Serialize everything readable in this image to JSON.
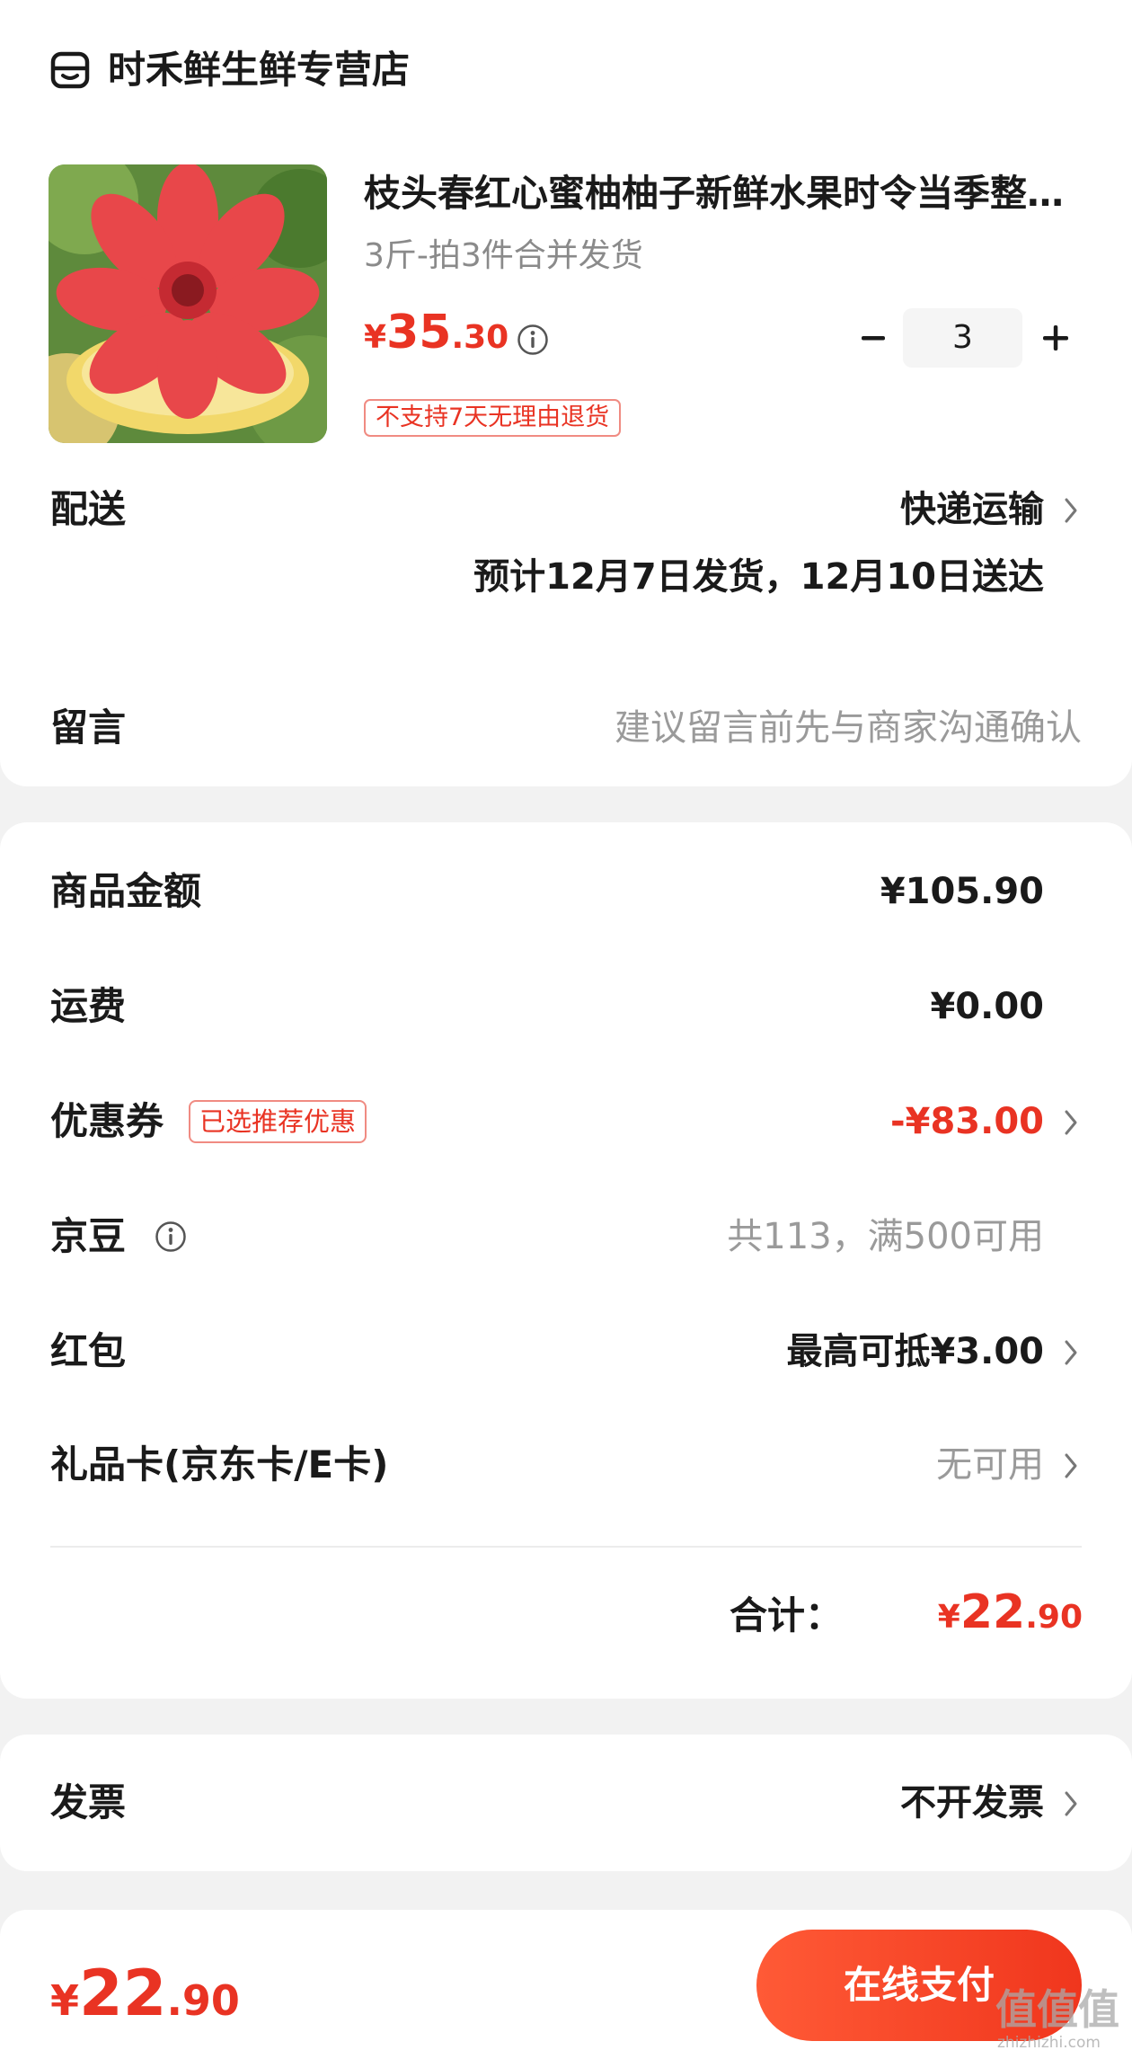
{
  "store": {
    "name": "时禾鲜生鲜专营店",
    "icon": "store-icon"
  },
  "product": {
    "title": "枝头春红心蜜柚柚子新鲜水果时令当季整箱包邮",
    "spec": "3斤-拍3件合并发货",
    "price": {
      "currency": "¥",
      "integer": "35",
      "decimal": ".30"
    },
    "return_tag": "不支持7天无理由退货",
    "quantity": "3",
    "minus_label": "−",
    "plus_label": "+"
  },
  "shipping": {
    "label": "配送",
    "method": "快递运输",
    "estimate": "预计12月7日发货，12月10日送达"
  },
  "remark": {
    "label": "留言",
    "placeholder": "建议留言前先与商家沟通确认"
  },
  "summary": {
    "goods_amount": {
      "label": "商品金额",
      "value": "¥105.90"
    },
    "freight": {
      "label": "运费",
      "value": "¥0.00"
    },
    "coupon": {
      "label": "优惠券",
      "tag": "已选推荐优惠",
      "value": "-¥83.00"
    },
    "jingdou": {
      "label": "京豆",
      "value": "共113，满500可用"
    },
    "red_packet": {
      "label": "红包",
      "value": "最高可抵¥3.00"
    },
    "gift_card": {
      "label": "礼品卡(京东卡/E卡)",
      "value": "无可用"
    },
    "total": {
      "label": "合计：",
      "currency": "¥",
      "integer": "22",
      "decimal": ".90"
    }
  },
  "invoice": {
    "label": "发票",
    "value": "不开发票"
  },
  "bottom_bar": {
    "price": {
      "currency": "¥",
      "integer": "22",
      "decimal": ".90"
    },
    "pay_button": "在线支付"
  },
  "watermark": {
    "main": "值值值",
    "sub": "zhizhizhi.com"
  },
  "colors": {
    "accent": "#e93323",
    "pay_gradient_start": "#ff5a36",
    "pay_gradient_end": "#f0361d",
    "muted": "#9a9a9a"
  }
}
